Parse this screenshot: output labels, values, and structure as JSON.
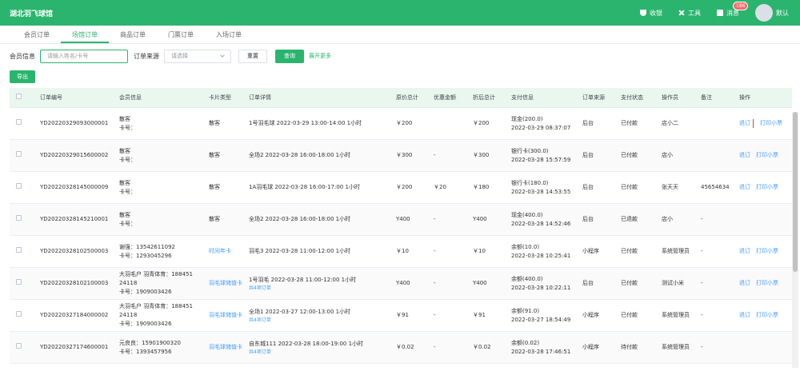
{
  "header": {
    "title": "湖北羽飞球馆",
    "nav": [
      {
        "label": "收银",
        "icon": "shield-icon"
      },
      {
        "label": "工具",
        "icon": "tool-icon"
      },
      {
        "label": "消息",
        "icon": "message-icon",
        "badge": "186"
      }
    ],
    "user": "默认"
  },
  "tabs": [
    "会员订单",
    "场馆订单",
    "商品订单",
    "门票订单",
    "入场订单"
  ],
  "active_tab": 1,
  "filter": {
    "member_label": "会员信息",
    "member_placeholder": "请输入姓名/卡号",
    "source_label": "订单来源",
    "source_placeholder": "请选择",
    "reset": "重置",
    "query": "查询",
    "expand": "展开更多"
  },
  "export": "导出",
  "columns": [
    "",
    "订单编号",
    "会员信息",
    "卡片类型",
    "订单详情",
    "原价总计",
    "优惠金额",
    "折后总计",
    "支付信息",
    "订单来源",
    "支付状态",
    "操作员",
    "备注",
    "操作"
  ],
  "rows": [
    {
      "order": "YD20220329093000001",
      "member1": "散客",
      "member2": "卡号：",
      "card1": "散客",
      "card2": "",
      "detail1": "1号羽毛球 2022-03-29 13:00-14:00  1小时",
      "detail2": "",
      "orig": "￥200",
      "disc": "",
      "net": "￥200",
      "pay1": "现金(200.0)",
      "pay2": "2022-03-29 08:37:07",
      "source": "后台",
      "status": "已付款",
      "operator": "店小二",
      "remark": "",
      "ops": [
        "退订",
        "打印小票"
      ]
    },
    {
      "order": "YD20220329015600002",
      "member1": "散客",
      "member2": "卡号：",
      "card1": "散客",
      "card2": "",
      "detail1": "全场2 2022-03-28 16:00-18:00  1小时",
      "detail2": "",
      "orig": "￥300",
      "disc": "-",
      "net": "￥300",
      "pay1": "银行卡(300.0)",
      "pay2": "2022-03-28 15:57:59",
      "source": "后台",
      "status": "已付款",
      "operator": "店小",
      "remark": "",
      "ops": [
        "退订",
        "打印小票"
      ]
    },
    {
      "order": "YD20220328145000009",
      "member1": "散客",
      "member2": "卡号：",
      "card1": "散客",
      "card2": "",
      "detail1": "1A羽毛球 2022-03-28 16:00-17:00  1小时",
      "detail2": "",
      "orig": "￥200",
      "disc": "￥20",
      "net": "￥180",
      "pay1": "银行卡(180.0)",
      "pay2": "2022-03-28 14:53:55",
      "source": "后台",
      "status": "已付款",
      "operator": "张天天",
      "remark": "45654634",
      "ops": [
        "退订",
        "打印小票"
      ]
    },
    {
      "order": "YD20220328145210001",
      "member1": "散客",
      "member2": "卡号：",
      "card1": "散客",
      "card2": "",
      "detail1": "全场2 2022-03-28 16:00-18:00  1小时",
      "detail2": "",
      "orig": "Y400",
      "disc": "-",
      "net": "Y400",
      "pay1": "现金(400.0)",
      "pay2": "2022-03-28 14:52:46",
      "source": "后台",
      "status": "已退款",
      "operator": "店小",
      "remark": "-",
      "ops": []
    },
    {
      "order": "YD20220328102500003",
      "member1": "谢强：13542611092",
      "member2": "卡号：1293045296",
      "card1": "时间年卡",
      "card2": "",
      "detail1": "羽毛3 2022-03-28 11:00-12:00  1小时",
      "detail2": "",
      "orig": "￥10",
      "disc": "-",
      "net": "￥10",
      "pay1": "余额(10.0)",
      "pay2": "2022-03-28 10:25:41",
      "source": "小程序",
      "status": "已付款",
      "operator": "系统管理员",
      "remark": "-",
      "ops": [
        "退订",
        "打印小票"
      ]
    },
    {
      "order": "YD20220328102100003",
      "member1": "大羽毛户 羽青体育：188451 24118",
      "member2": "卡号：1909003426",
      "card1": "羽毛球储值卡",
      "card2": "",
      "detail1": "1号羽毛 2022-03-28 11:00-12:00  1小时",
      "detail2": "共4项订单",
      "orig": "Y400",
      "disc": "-",
      "net": "Y400",
      "pay1": "余额(400.0)",
      "pay2": "2022-03-28 10:22:11",
      "source": "后台",
      "status": "已付款",
      "operator": "测试小米",
      "remark": "-",
      "ops": [
        "退订",
        "打印小票"
      ]
    },
    {
      "order": "YD20220327184000002",
      "member1": "大羽毛户 羽青体育：188451 24118",
      "member2": "卡号：1909003426",
      "card1": "羽毛球储值卡",
      "card2": "",
      "detail1": "全场1 2022-03-27 12:00-13:00  1小时",
      "detail2": "共4项订单",
      "orig": "￥91",
      "disc": "-",
      "net": "￥91",
      "pay1": "余额(91.0)",
      "pay2": "2022-03-27 18:54:49",
      "source": "小程序",
      "status": "已付款",
      "operator": "系统管理员",
      "remark": "-",
      "ops": [
        "退订",
        "打印小票"
      ]
    },
    {
      "order": "YD20220327174600001",
      "member1": "元良良：15901900320",
      "member2": "卡号：1393457956",
      "card1": "羽毛球储值卡",
      "card2": "",
      "detail1": "自东城111 2022-03-28 18:00-19:00  1小时",
      "detail2": "共4项订单",
      "orig": "￥0.02",
      "disc": "-",
      "net": "￥0.02",
      "pay1": "余额(0.02)",
      "pay2": "2022-03-28 17:46:51",
      "source": "小程序",
      "status": "待付款",
      "operator": "系统管理员",
      "remark": "-",
      "ops": []
    }
  ]
}
